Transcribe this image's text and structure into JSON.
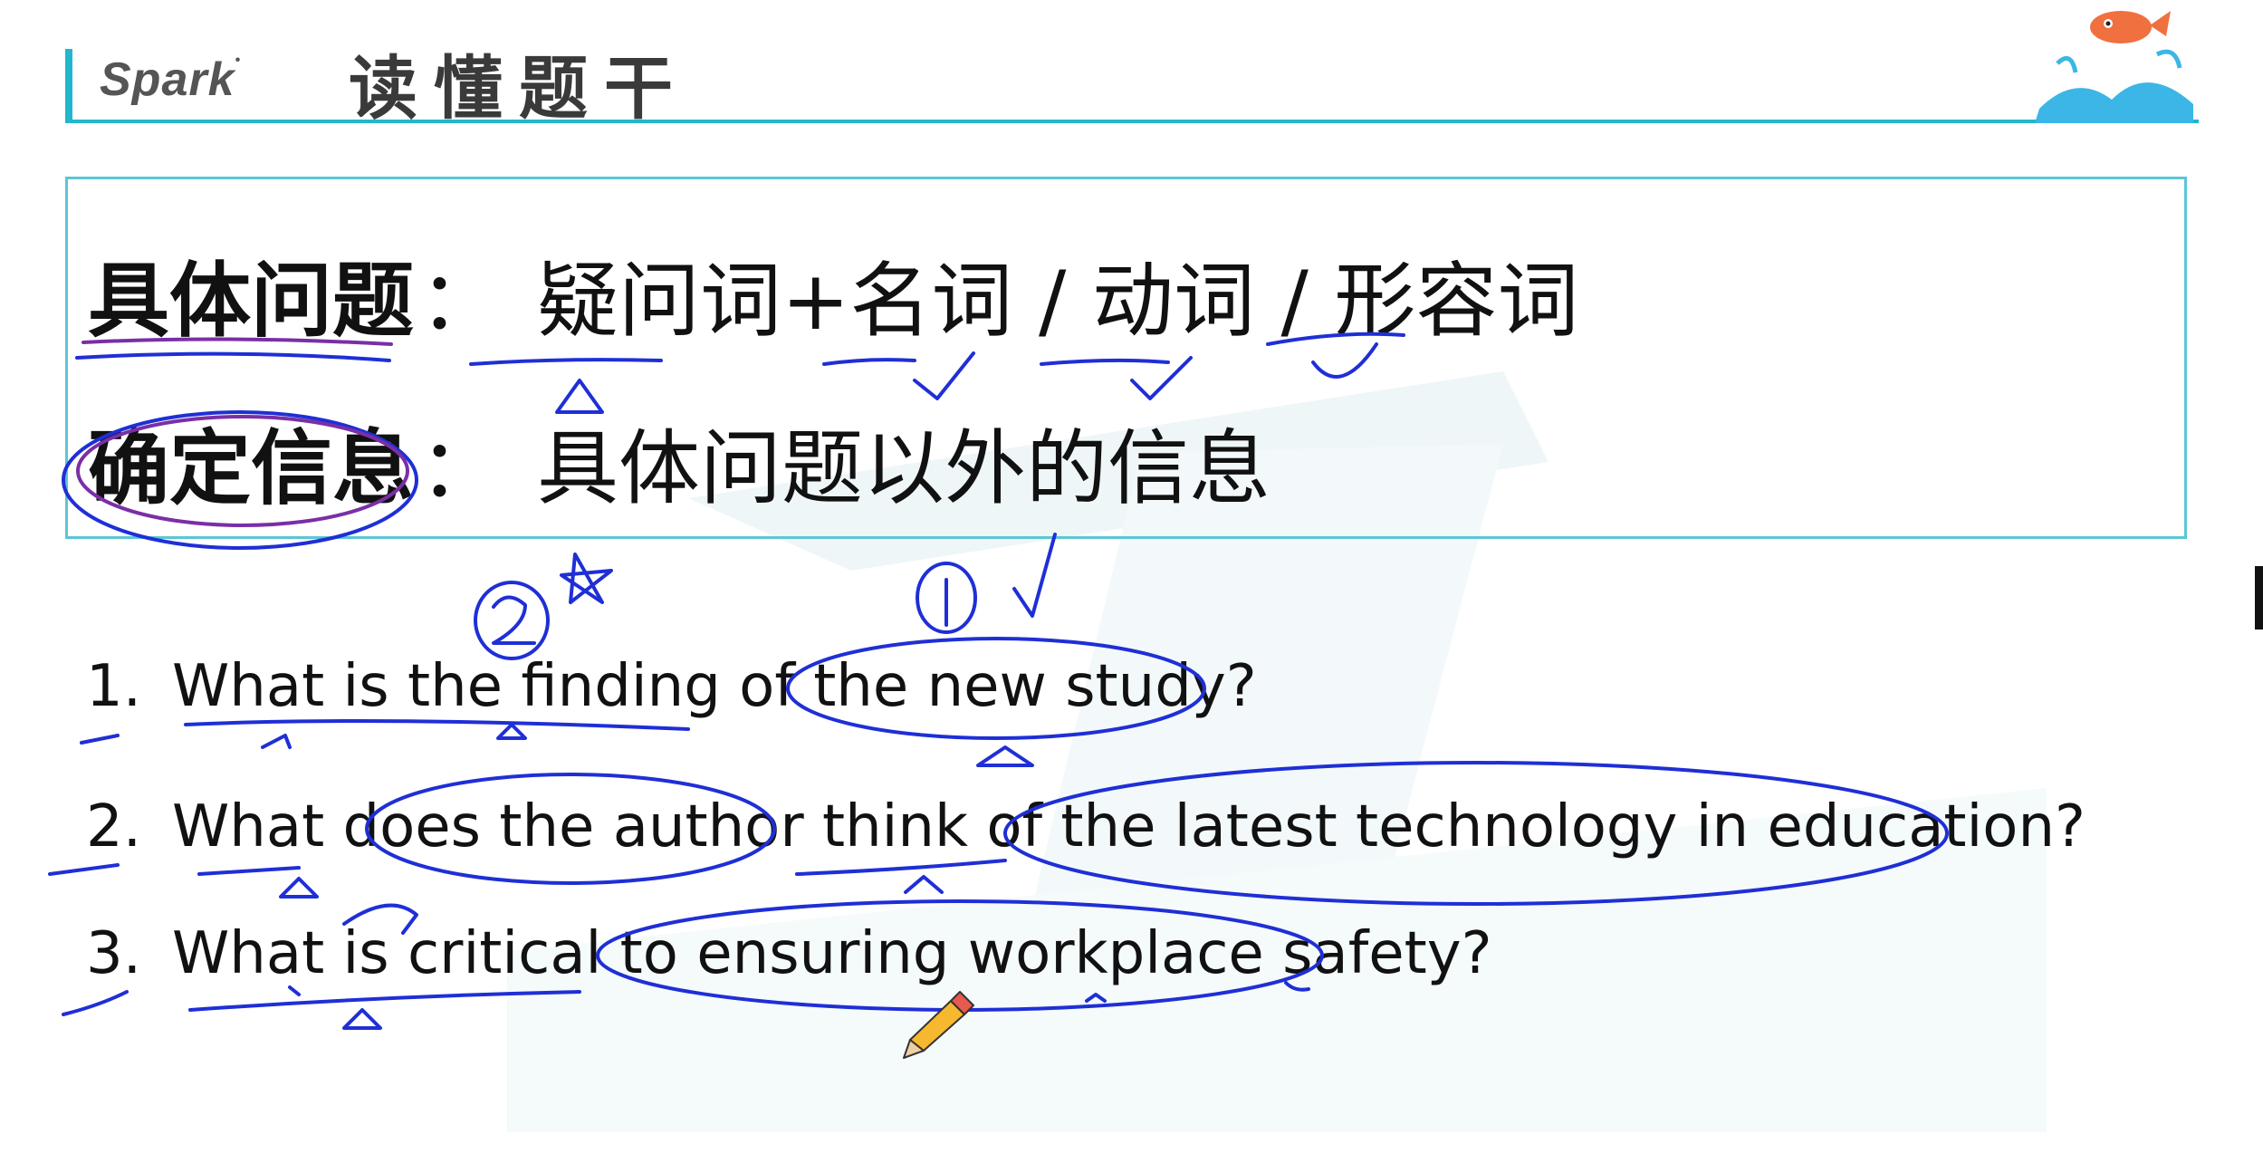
{
  "header": {
    "brand": "Spark",
    "title": "读懂题干"
  },
  "definitions": [
    {
      "term": "具体问题",
      "colon": "：",
      "desc": "疑问词+名词 / 动词 / 形容词"
    },
    {
      "term": "确定信息",
      "colon": "：",
      "desc": "具体问题以外的信息"
    }
  ],
  "questions": [
    {
      "num": "1.",
      "text": "What is the finding of the new study?"
    },
    {
      "num": "2.",
      "text": "What does the author think of the latest technology in education?"
    },
    {
      "num": "3.",
      "text": "What is critical to ensuring workplace safety?"
    }
  ],
  "annotation_marks": [
    "②",
    "①",
    "✓",
    "★",
    "△"
  ],
  "colors": {
    "accent": "#23b6cc",
    "box_border": "#5cc6d6",
    "ink_blue": "#1f2fd6",
    "ink_purple": "#7a2fa6"
  }
}
